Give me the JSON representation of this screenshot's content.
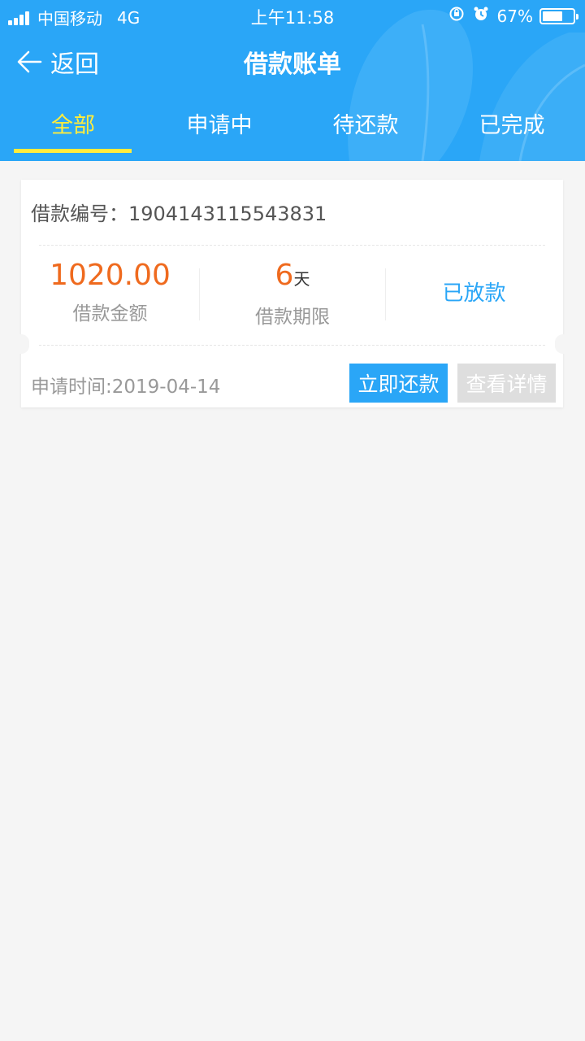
{
  "status_bar": {
    "carrier": "中国移动",
    "network": "4G",
    "time": "上午11:58",
    "battery": "67%",
    "battery_level": 0.67
  },
  "navbar": {
    "back_label": "返回",
    "title": "借款账单"
  },
  "tabs": [
    {
      "label": "全部",
      "active": true
    },
    {
      "label": "申请中",
      "active": false
    },
    {
      "label": "待还款",
      "active": false
    },
    {
      "label": "已完成",
      "active": false
    }
  ],
  "loan": {
    "number_label": "借款编号：",
    "number": "1904143115543831",
    "amount": "1020.00",
    "amount_label": "借款金额",
    "term_value": "6",
    "term_unit": "天",
    "term_label": "借款期限",
    "status": "已放款",
    "apply_time": "申请时间:2019-04-14",
    "repay_button": "立即还款",
    "detail_button": "查看详情"
  },
  "colors": {
    "brand_blue": "#2aa6f7",
    "accent_yellow": "#ffec3d",
    "amount_orange": "#ef6a1e"
  }
}
